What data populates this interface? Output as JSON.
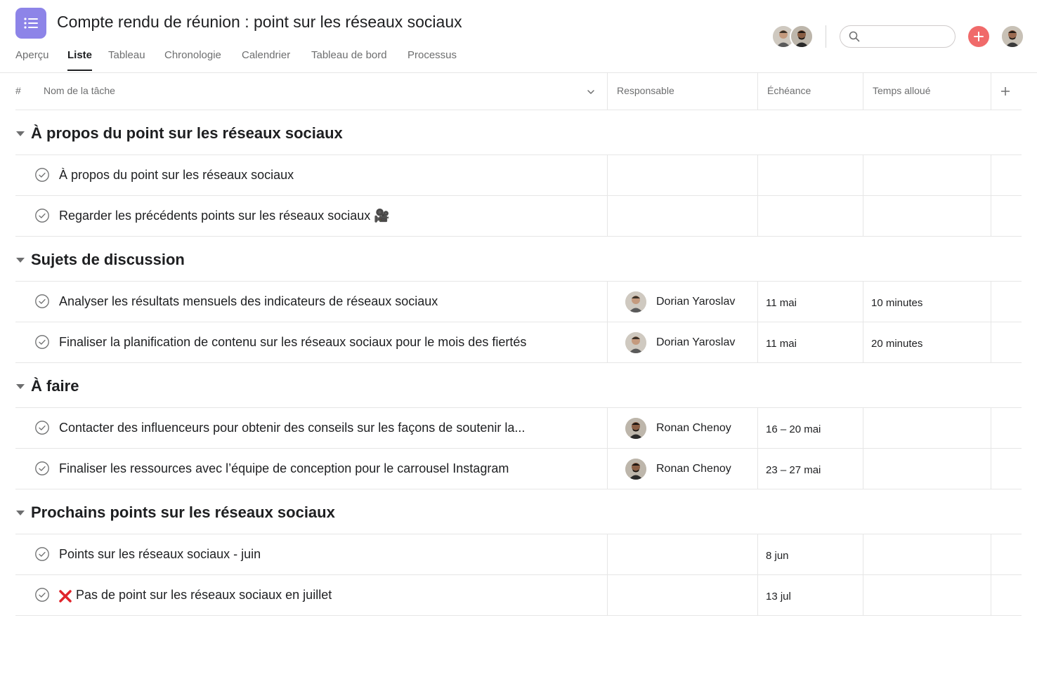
{
  "project": {
    "title": "Compte rendu de réunion : point sur les réseaux sociaux",
    "icon": "list-icon",
    "icon_color": "#8d84e8"
  },
  "tabs": [
    {
      "label": "Aperçu",
      "active": false
    },
    {
      "label": "Liste",
      "active": true
    },
    {
      "label": "Tableau",
      "active": false
    },
    {
      "label": "Chronologie",
      "active": false
    },
    {
      "label": "Calendrier",
      "active": false
    },
    {
      "label": "Tableau de bord",
      "active": false
    },
    {
      "label": "Processus",
      "active": false
    }
  ],
  "toolbar": {
    "search_placeholder": "",
    "add_button_color": "#f06a6a",
    "add_icon": "plus-icon"
  },
  "columns": {
    "number": "#",
    "task": "Nom de la tâche",
    "assignee": "Responsable",
    "due": "Échéance",
    "time": "Temps alloué",
    "add_icon": "plus-icon"
  },
  "sections": [
    {
      "title": "À propos du point sur les réseaux sociaux",
      "tasks": [
        {
          "name": "À propos du point sur les réseaux sociaux",
          "assignee": "",
          "due": "",
          "time": ""
        },
        {
          "name": "Regarder les précédents points sur les réseaux sociaux 🎥",
          "assignee": "",
          "due": "",
          "time": ""
        }
      ]
    },
    {
      "title": "Sujets de discussion",
      "tasks": [
        {
          "name": "Analyser les résultats mensuels des indicateurs de réseaux sociaux",
          "assignee": "Dorian Yaroslav",
          "due": "11 mai",
          "time": "10 minutes"
        },
        {
          "name": "Finaliser la planification de contenu sur les réseaux sociaux pour le mois des fiertés",
          "assignee": "Dorian Yaroslav",
          "due": "11 mai",
          "time": "20 minutes"
        }
      ]
    },
    {
      "title": "À faire",
      "tasks": [
        {
          "name": "Contacter des influenceurs pour obtenir des conseils sur les façons de soutenir la...",
          "assignee": "Ronan Chenoy",
          "due": "16 – 20 mai",
          "time": ""
        },
        {
          "name": "Finaliser les ressources avec l’équipe de conception pour le carrousel Instagram",
          "assignee": "Ronan Chenoy",
          "due": "23 – 27 mai",
          "time": ""
        }
      ]
    },
    {
      "title": "Prochains points sur les réseaux sociaux",
      "tasks": [
        {
          "name": "Points sur les réseaux sociaux - juin",
          "assignee": "",
          "due": "8 jun",
          "time": ""
        },
        {
          "name": "Pas de point sur les réseaux sociaux en juillet",
          "prefix_icon": "red-x-icon",
          "assignee": "",
          "due": "13 jul",
          "time": ""
        }
      ]
    }
  ]
}
